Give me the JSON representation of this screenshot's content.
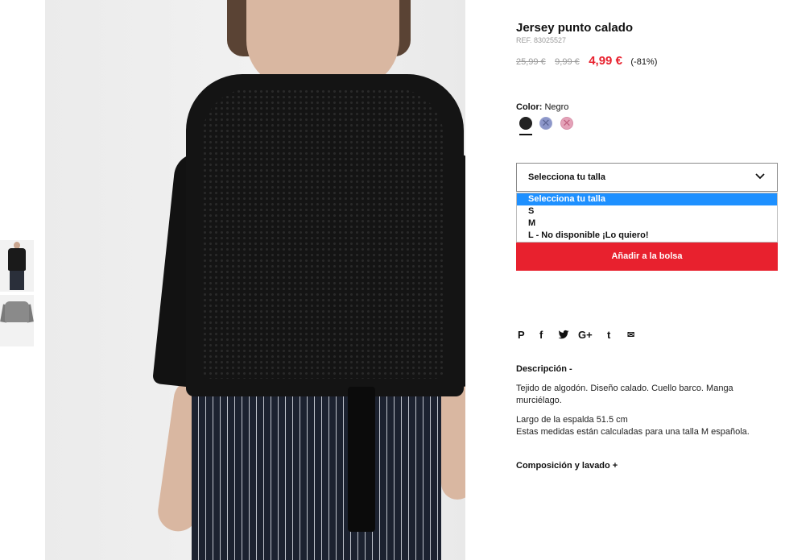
{
  "product": {
    "title": "Jersey punto calado",
    "ref": "REF. 83025527",
    "price_original": "25,99 €",
    "price_previous": "9,99 €",
    "price_current": "4,99 €",
    "discount": "(-81%)",
    "accent_color": "#e8212e"
  },
  "color": {
    "label": "Color:",
    "value": "Negro",
    "swatches": [
      {
        "name": "black",
        "hex": "#222222",
        "available": true
      },
      {
        "name": "blue",
        "hex": "#8c96c9",
        "available": false
      },
      {
        "name": "pink",
        "hex": "#e4a2b8",
        "available": false
      }
    ]
  },
  "size": {
    "select_label": "Selecciona tu talla",
    "options": [
      "Selecciona tu talla",
      "S",
      "M",
      "L - No disponible ¡Lo quiero!"
    ]
  },
  "add_to_bag": "Añadir a la bolsa",
  "social": {
    "pinterest": "P",
    "facebook": "f",
    "twitter": "🐦",
    "googleplus": "G+",
    "tumblr": "t",
    "email": "✉"
  },
  "description": {
    "heading": "Descripción -",
    "line1": "Tejido de algodón. Diseño calado. Cuello barco. Manga murciélago.",
    "line2": "Largo de la espalda 51.5 cm",
    "line3": "Estas medidas están calculadas para una talla M española."
  },
  "composition": {
    "heading": "Composición y lavado +"
  }
}
